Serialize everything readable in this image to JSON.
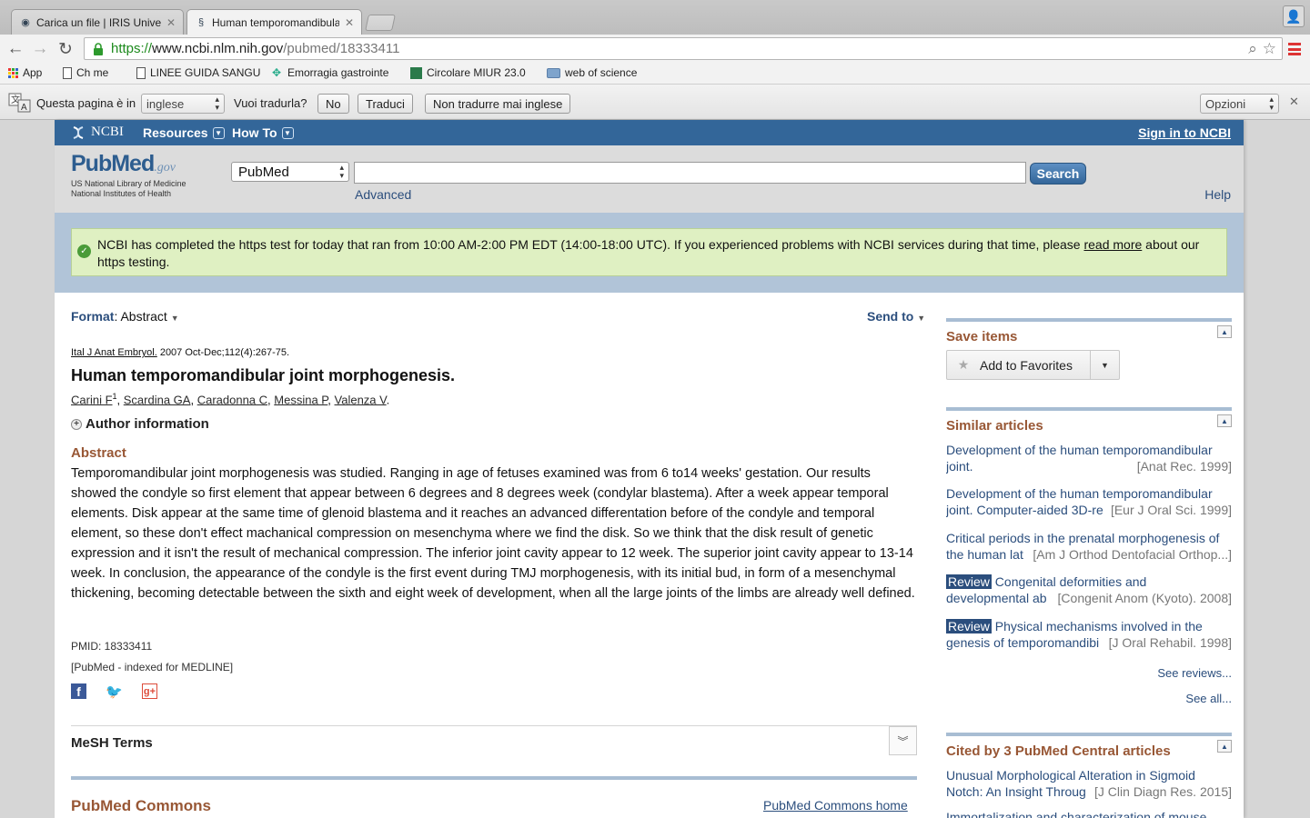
{
  "browser": {
    "tabs": [
      {
        "title": "Carica un file | IRIS Univers",
        "icon": "globe-icon"
      },
      {
        "title": "Human temporomandibula",
        "icon": "ncbi-icon"
      }
    ],
    "url": {
      "scheme": "https://",
      "host": "www.ncbi.nlm.nih.gov",
      "path": "/pubmed/18333411"
    },
    "bookmarks": [
      {
        "label": "App",
        "icon": "apps-icon"
      },
      {
        "label": "Ch  me",
        "icon": "page-icon"
      },
      {
        "label": "LINEE GUIDA SANGUI",
        "icon": "page-icon"
      },
      {
        "label": "Emorragia gastrointe",
        "icon": "site-icon"
      },
      {
        "label": "Circolare MIUR 23.0",
        "icon": "site-icon"
      },
      {
        "label": "web of science",
        "icon": "folder-icon"
      }
    ],
    "translate": {
      "prompt": "Questa pagina è in",
      "language": "inglese",
      "question": "Vuoi tradurla?",
      "no": "No",
      "translate": "Traduci",
      "never": "Non tradurre mai inglese",
      "options": "Opzioni"
    }
  },
  "ncbi": {
    "logo": "NCBI",
    "resources": "Resources",
    "howto": "How To",
    "signin": "Sign in to NCBI"
  },
  "search": {
    "logo_main": "PubMed",
    "logo_gov": ".gov",
    "sub1": "US National Library of Medicine",
    "sub2": "National Institutes of Health",
    "database": "PubMed",
    "query": "",
    "button": "Search",
    "advanced": "Advanced",
    "help": "Help"
  },
  "notice": {
    "text_before": "NCBI has completed the https test for today that ran from 10:00 AM-2:00 PM EDT (14:00-18:00 UTC). If you experienced problems with NCBI services during that time, please ",
    "link": "read more",
    "text_after": " about our https testing."
  },
  "article": {
    "format_label": "Format",
    "format_value": "Abstract",
    "send_to": "Send to",
    "journal": "Ital J Anat Embryol.",
    "citation": " 2007 Oct-Dec;112(4):267-75.",
    "title": "Human temporomandibular joint morphogenesis.",
    "authors": [
      "Carini F",
      "Scardina GA",
      "Caradonna C",
      "Messina P",
      "Valenza V"
    ],
    "author_info": "Author information",
    "abstract_heading": "Abstract",
    "abstract": "Temporomandibular joint morphogenesis was studied. Ranging in age of fetuses examined was from 6 to14 weeks' gestation. Our results showed the condyle so first element that appear between 6 degrees and 8 degrees week (condylar blastema). After a week appear temporal elements. Disk appear at the same time of glenoid blastema and it reaches an advanced differentation before of the condyle and temporal element, so these don't effect machanical compression on mesenchyma where we find the disk. So we think that the disk result of genetic expression and it isn't the result of mechanical compression. The inferior joint cavity appear to 12 week. The superior joint cavity appear to 13-14 week. In conclusion, the appearance of the condyle is the first event during TMJ morphogenesis, with its initial bud, in form of a mesenchymal thickening, becoming detectable between the sixth and eight week of development, when all the large joints of the limbs are already well defined.",
    "pmid": "PMID: 18333411",
    "indexed": "[PubMed - indexed for MEDLINE]",
    "mesh": "MeSH Terms",
    "commons": "PubMed Commons",
    "commons_home": "PubMed Commons home"
  },
  "sidebar": {
    "save_items": "Save items",
    "add_favorites": "Add to Favorites",
    "similar_title": "Similar articles",
    "similar": [
      {
        "badge": "",
        "line1": "Development of the human temporomandibular",
        "line2": "joint.",
        "source": "[Anat Rec. 1999]"
      },
      {
        "badge": "",
        "line1": "Development of the human temporomandibular",
        "line2": "joint. Computer-aided 3D-re",
        "source": "[Eur J Oral Sci. 1999]"
      },
      {
        "badge": "",
        "line1": "Critical periods in the prenatal morphogenesis of",
        "line2": "the human lat",
        "source": "[Am J Orthod Dentofacial Orthop...]"
      },
      {
        "badge": "Review",
        "line1": " Congenital deformities and",
        "line2": "developmental ab",
        "source": "[Congenit Anom (Kyoto). 2008]"
      },
      {
        "badge": "Review",
        "line1": " Physical mechanisms involved in the",
        "line2": "genesis of temporomandibi",
        "source": "[J Oral Rehabil. 1998]"
      }
    ],
    "see_reviews": "See reviews...",
    "see_all": "See all...",
    "cited_title": "Cited by 3 PubMed Central articles",
    "cited": [
      {
        "line1": "Unusual Morphological Alteration in Sigmoid",
        "line2": "Notch: An Insight Throug",
        "source": "[J Clin Diagn Res. 2015]"
      },
      {
        "line1": "Immortalization and characterization of mouse",
        "line2": "",
        "source": ""
      }
    ]
  }
}
